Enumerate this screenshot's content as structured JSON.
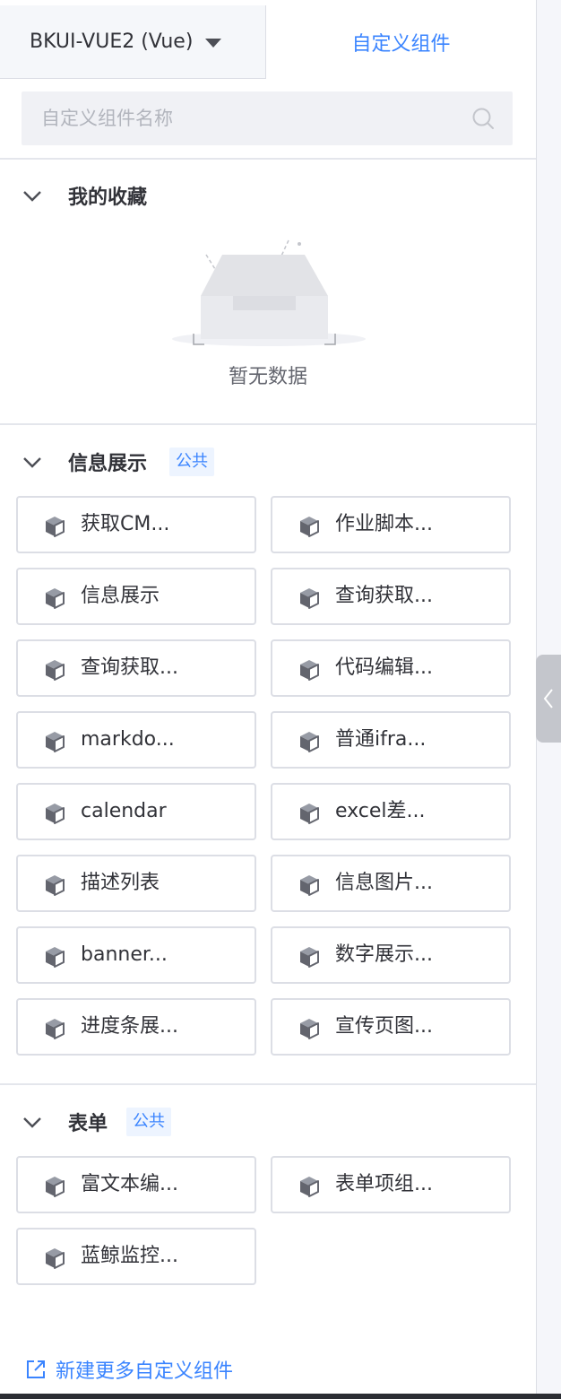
{
  "tabs": {
    "library_label": "BKUI-VUE2 (Vue)",
    "custom_label": "自定义组件"
  },
  "search": {
    "placeholder": "自定义组件名称"
  },
  "favorites": {
    "title": "我的收藏",
    "empty_text": "暂无数据"
  },
  "info_group": {
    "title": "信息展示",
    "tag": "公共",
    "items": [
      "获取CM...",
      "作业脚本...",
      "信息展示",
      "查询获取...",
      "查询获取...",
      "代码编辑...",
      "markdo...",
      "普通ifra...",
      "calendar",
      "excel差...",
      "描述列表",
      "信息图片...",
      "banner...",
      "数字展示...",
      "进度条展...",
      "宣传页图..."
    ]
  },
  "form_group": {
    "title": "表单",
    "tag": "公共",
    "items": [
      "富文本编...",
      "表单项组...",
      "蓝鲸监控..."
    ]
  },
  "footer": {
    "link_label": "新建更多自定义组件"
  },
  "colors": {
    "accent": "#3a84ff",
    "text": "#313238",
    "border": "#dcdee5"
  },
  "icons": {
    "library_dropdown": "caret-down-icon",
    "search": "search-icon",
    "group_toggle": "chevron-down-icon",
    "component": "cube-icon",
    "empty": "empty-box-icon",
    "footer": "external-link-icon",
    "collapse": "chevron-left-icon"
  }
}
